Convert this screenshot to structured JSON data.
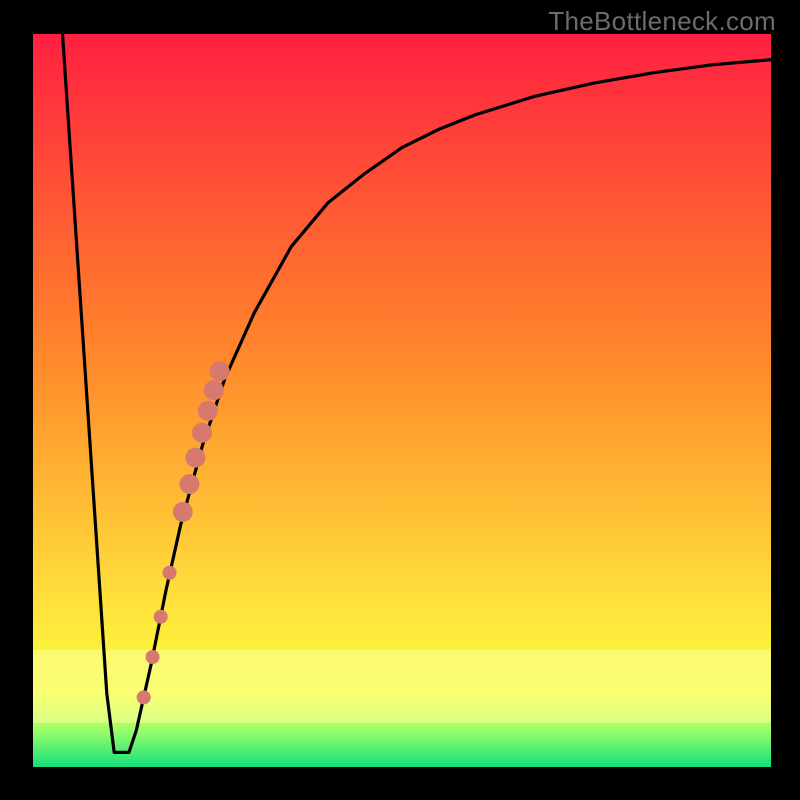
{
  "watermark": "TheBottleneck.com",
  "colors": {
    "border": "#000000",
    "curve": "#000000",
    "dot_fill": "#d77a6e",
    "dot_stroke": "#b85c52",
    "gradient_top": "#ff2040",
    "gradient_mid1": "#ff8a2a",
    "gradient_mid2": "#ffe23c",
    "gradient_band": "#f7ff3b",
    "gradient_green1": "#9bff6b",
    "gradient_green2": "#14e07c"
  },
  "chart_data": {
    "type": "line",
    "title": "",
    "xlabel": "",
    "ylabel": "",
    "xlim": [
      0,
      100
    ],
    "ylim": [
      0,
      100
    ],
    "series": [
      {
        "name": "bottleneck-curve",
        "x": [
          4,
          6,
          8,
          10,
          11,
          12,
          13,
          14,
          16,
          18,
          20,
          23,
          26,
          30,
          35,
          40,
          45,
          50,
          55,
          60,
          68,
          76,
          84,
          92,
          100
        ],
        "y": [
          100,
          70,
          40,
          10,
          2,
          2,
          2,
          5,
          14,
          24,
          33,
          44,
          53,
          62,
          71,
          77,
          81,
          84.5,
          87,
          89,
          91.5,
          93.3,
          94.7,
          95.8,
          96.5
        ]
      }
    ],
    "scatter_points": [
      {
        "x": 15.0,
        "y": 9.5
      },
      {
        "x": 16.2,
        "y": 15.0
      },
      {
        "x": 17.3,
        "y": 20.5
      },
      {
        "x": 18.5,
        "y": 26.5
      },
      {
        "x": 20.3,
        "y": 34.8
      },
      {
        "x": 21.2,
        "y": 38.6
      },
      {
        "x": 22.0,
        "y": 42.2
      },
      {
        "x": 22.9,
        "y": 45.6
      },
      {
        "x": 23.7,
        "y": 48.6
      },
      {
        "x": 24.5,
        "y": 51.4
      },
      {
        "x": 25.3,
        "y": 54.0
      }
    ],
    "scatter_radius": [
      7,
      7,
      7,
      7,
      10,
      10,
      10,
      10,
      10,
      10,
      10
    ],
    "green_band_y": 4
  }
}
